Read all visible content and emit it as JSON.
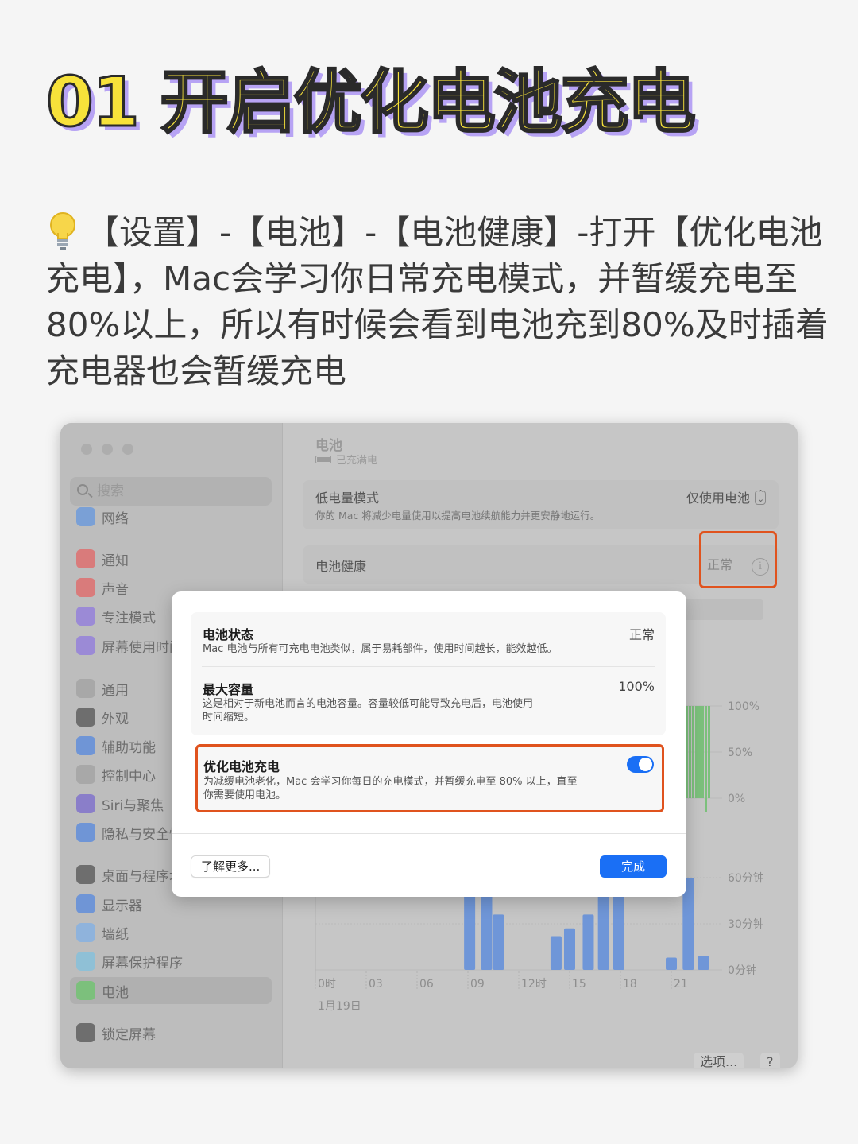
{
  "headline": "01 开启优化电池充电",
  "tip_icon": "lightbulb-icon",
  "tip_text": "【设置】-【电池】-【电池健康】-打开【优化电池充电】，Mac会学习你日常充电模式，并暂缓充电至80%以上，所以有时候会看到电池充到80%及时插着充电器也会暂缓充电",
  "sidebar": {
    "search_placeholder": "搜索",
    "items": [
      {
        "label": "网络",
        "icon": "globe-icon",
        "color": "#7aa0d6"
      },
      {
        "label": "通知",
        "icon": "bell-icon",
        "color": "#d97b7b"
      },
      {
        "label": "声音",
        "icon": "speaker-icon",
        "color": "#d97b7b"
      },
      {
        "label": "专注模式",
        "icon": "moon-icon",
        "color": "#9b8ad6"
      },
      {
        "label": "屏幕使用时间",
        "icon": "hourglass-icon",
        "color": "#9b8ad6"
      },
      {
        "label": "通用",
        "icon": "gear-icon",
        "color": "#a8a8a8"
      },
      {
        "label": "外观",
        "icon": "appearance-icon",
        "color": "#6e6e6e"
      },
      {
        "label": "辅助功能",
        "icon": "accessibility-icon",
        "color": "#6f95d6"
      },
      {
        "label": "控制中心",
        "icon": "toggles-icon",
        "color": "#a8a8a8"
      },
      {
        "label": "Siri与聚焦",
        "icon": "siri-icon",
        "color": "#8a7ec9"
      },
      {
        "label": "隐私与安全性",
        "icon": "hand-icon",
        "color": "#6f95d6"
      },
      {
        "label": "桌面与程序坞",
        "icon": "dock-icon",
        "color": "#6e6e6e"
      },
      {
        "label": "显示器",
        "icon": "sun-icon",
        "color": "#6f95d6"
      },
      {
        "label": "墙纸",
        "icon": "flower-icon",
        "color": "#8fb3dc"
      },
      {
        "label": "屏幕保护程序",
        "icon": "screensaver-icon",
        "color": "#8fc0d6"
      },
      {
        "label": "电池",
        "icon": "battery-icon",
        "color": "#7cc07c"
      },
      {
        "label": "锁定屏幕",
        "icon": "lock-icon",
        "color": "#6e6e6e"
      }
    ]
  },
  "main": {
    "title": "电池",
    "subtitle": "已充满电",
    "low_power": {
      "label": "低电量模式",
      "desc": "你的 Mac 将减少电量使用以提高电池续航能力并更安静地运行。",
      "value": "仅使用电池"
    },
    "health": {
      "label": "电池健康",
      "value": "正常"
    },
    "options_button": "选项...",
    "help_button": "?"
  },
  "chart_data": [
    {
      "type": "bar",
      "title": "",
      "y_ticks": [
        "100%",
        "50%",
        "0%"
      ],
      "note": "partially hidden behind dialog"
    },
    {
      "type": "bar",
      "x_ticks": [
        "0时",
        "03",
        "06",
        "09",
        "12时",
        "15",
        "18",
        "21"
      ],
      "x_sublabel": "1月19日",
      "y_ticks": [
        "60分钟",
        "30分钟",
        "0分钟"
      ],
      "ylim": [
        0,
        60
      ],
      "series": [
        {
          "values": [
            {
              "x": 9.1,
              "y": 55
            },
            {
              "x": 10.1,
              "y": 55
            },
            {
              "x": 10.8,
              "y": 36
            },
            {
              "x": 14.2,
              "y": 22
            },
            {
              "x": 15.0,
              "y": 27
            },
            {
              "x": 16.1,
              "y": 36
            },
            {
              "x": 17.0,
              "y": 54
            },
            {
              "x": 17.9,
              "y": 52
            },
            {
              "x": 21.0,
              "y": 8
            },
            {
              "x": 22.0,
              "y": 60
            },
            {
              "x": 22.9,
              "y": 9
            }
          ]
        }
      ]
    }
  ],
  "dialog": {
    "status": {
      "title": "电池状态",
      "value": "正常",
      "desc": "Mac 电池与所有可充电电池类似，属于易耗部件，使用时间越长，能效越低。"
    },
    "capacity": {
      "title": "最大容量",
      "value": "100%",
      "desc_line1": "这是相对于新电池而言的电池容量。容量较低可能导致充电后，电池使用",
      "desc_line2": "时间缩短。"
    },
    "optimize": {
      "title": "优化电池充电",
      "desc_line1": "为减缓电池老化，Mac 会学习你每日的充电模式，并暂缓充电至 80% 以上，直至",
      "desc_line2": "你需要使用电池。",
      "enabled": true
    },
    "learn_more": "了解更多...",
    "done": "完成"
  },
  "colors": {
    "headline_fill": "#f7e23a",
    "headline_shadow": "#b7a3f4",
    "highlight": "#e0531e",
    "accent_blue": "#1a6ff5",
    "bar_blue": "#6f96d8",
    "bar_green": "#7cc07c"
  }
}
